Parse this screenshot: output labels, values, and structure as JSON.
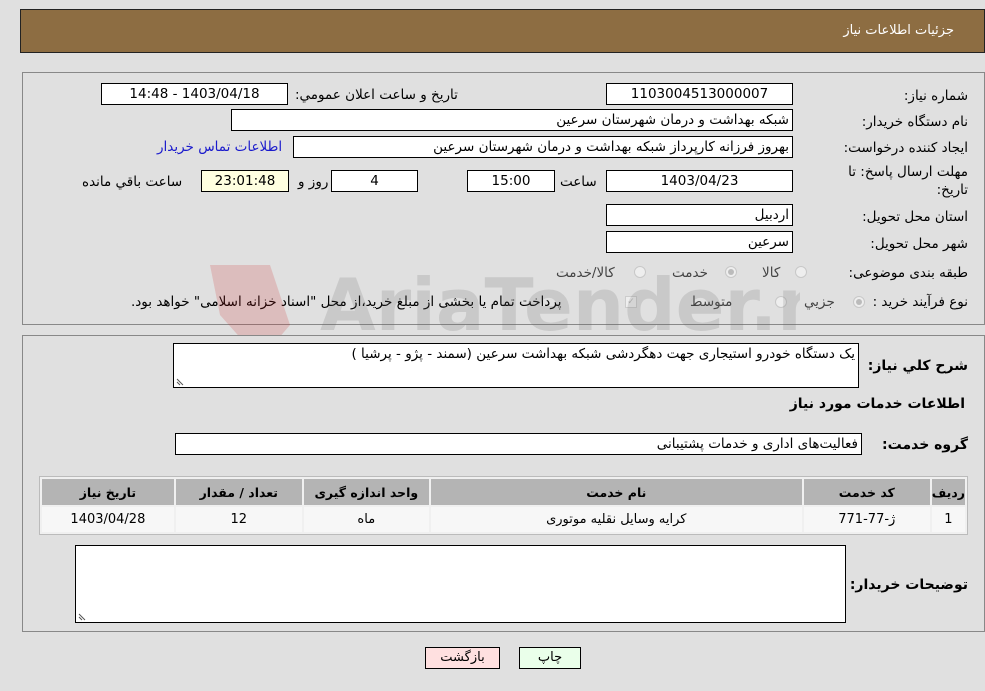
{
  "header": {
    "title": "جزئيات اطلاعات نياز"
  },
  "form": {
    "need_number_label": "شماره نياز:",
    "need_number": "1103004513000007",
    "announce_label": "تاريخ و ساعت اعلان عمومي:",
    "announce_value": "1403/04/18 - 14:48",
    "buyer_org_label": "نام دستگاه خريدار:",
    "buyer_org": "شبکه بهداشت و درمان شهرستان سرعين",
    "creator_label": "ايجاد کننده درخواست:",
    "creator": "بهروز فرزانه کارپرداز شبکه بهداشت و درمان شهرستان سرعين",
    "contact_link": "اطلاعات تماس خريدار",
    "deadline_label_1": "مهلت ارسال پاسخ: تا",
    "deadline_label_2": "تاريخ:",
    "deadline_date": "1403/04/23",
    "time_label": "ساعت",
    "deadline_time": "15:00",
    "days_value": "4",
    "days_label": "روز و",
    "remaining_time": "23:01:48",
    "remaining_label": "ساعت باقي مانده",
    "province_label": "استان محل تحويل:",
    "province": "اردبيل",
    "city_label": "شهر محل تحويل:",
    "city": "سرعين",
    "category_label": "طبقه بندی موضوعی:",
    "category_options": [
      "کالا",
      "خدمت",
      "کالا/خدمت"
    ],
    "category_selected": "خدمت",
    "process_label": "نوع فرآيند خريد :",
    "process_options": [
      "جزيي",
      "متوسط"
    ],
    "process_selected": "جزيي",
    "treasury_note": "پرداخت تمام يا بخشی از مبلغ خريد،از محل \"اسناد خزانه اسلامی\" خواهد بود."
  },
  "details": {
    "summary_label": "شرح کلي نياز:",
    "summary": "يک دستگاه خودرو استيجاری جهت دهگردشی شبکه بهداشت سرعين (سمند - پژو - پرشيا )",
    "services_heading": "اطلاعات خدمات مورد نياز",
    "service_group_label": "گروه خدمت:",
    "service_group": "فعاليت‌های اداری و خدمات پشتيبانی",
    "table": {
      "headers": [
        "رديف",
        "کد خدمت",
        "نام خدمت",
        "واحد اندازه گيری",
        "تعداد / مقدار",
        "تاريخ نياز"
      ],
      "rows": [
        [
          "1",
          "ژ-77-771",
          "کرايه وسايل نقليه موتوری",
          "ماه",
          "12",
          "1403/04/28"
        ]
      ]
    },
    "buyer_notes_label": "توضيحات خريدار:",
    "buyer_notes": ""
  },
  "buttons": {
    "print": "چاپ",
    "back": "بازگشت"
  },
  "watermark": "AriaTender.neT"
}
